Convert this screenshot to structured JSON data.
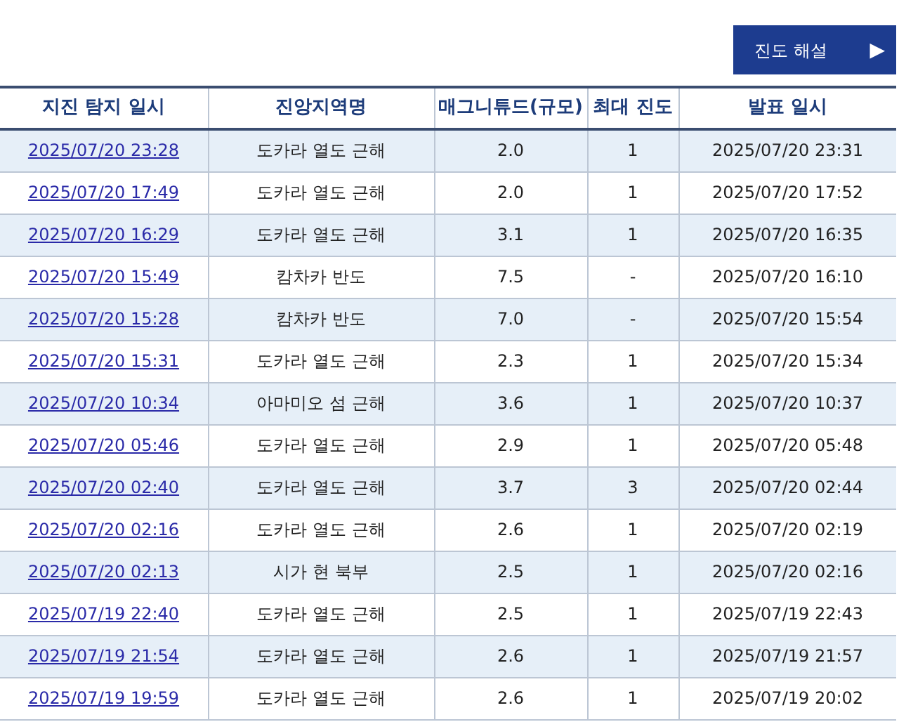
{
  "guide_button": {
    "label": "진도 해설",
    "icon": "▶"
  },
  "table": {
    "columns": [
      "지진 탐지 일시",
      "진앙지역명",
      "매그니튜드(규모)",
      "최대 진도",
      "발표 일시"
    ],
    "rows": [
      {
        "detected": "2025/07/20 23:28",
        "region": "도카라 열도 근해",
        "magnitude": "2.0",
        "max_intensity": "1",
        "announced": "2025/07/20 23:31"
      },
      {
        "detected": "2025/07/20 17:49",
        "region": "도카라 열도 근해",
        "magnitude": "2.0",
        "max_intensity": "1",
        "announced": "2025/07/20 17:52"
      },
      {
        "detected": "2025/07/20 16:29",
        "region": "도카라 열도 근해",
        "magnitude": "3.1",
        "max_intensity": "1",
        "announced": "2025/07/20 16:35"
      },
      {
        "detected": "2025/07/20 15:49",
        "region": "캄차카 반도",
        "magnitude": "7.5",
        "max_intensity": "-",
        "announced": "2025/07/20 16:10"
      },
      {
        "detected": "2025/07/20 15:28",
        "region": "캄차카 반도",
        "magnitude": "7.0",
        "max_intensity": "-",
        "announced": "2025/07/20 15:54"
      },
      {
        "detected": "2025/07/20 15:31",
        "region": "도카라 열도 근해",
        "magnitude": "2.3",
        "max_intensity": "1",
        "announced": "2025/07/20 15:34"
      },
      {
        "detected": "2025/07/20 10:34",
        "region": "아마미오 섬 근해",
        "magnitude": "3.6",
        "max_intensity": "1",
        "announced": "2025/07/20 10:37"
      },
      {
        "detected": "2025/07/20 05:46",
        "region": "도카라 열도 근해",
        "magnitude": "2.9",
        "max_intensity": "1",
        "announced": "2025/07/20 05:48"
      },
      {
        "detected": "2025/07/20 02:40",
        "region": "도카라 열도 근해",
        "magnitude": "3.7",
        "max_intensity": "3",
        "announced": "2025/07/20 02:44"
      },
      {
        "detected": "2025/07/20 02:16",
        "region": "도카라 열도 근해",
        "magnitude": "2.6",
        "max_intensity": "1",
        "announced": "2025/07/20 02:19"
      },
      {
        "detected": "2025/07/20 02:13",
        "region": "시가 현 북부",
        "magnitude": "2.5",
        "max_intensity": "1",
        "announced": "2025/07/20 02:16"
      },
      {
        "detected": "2025/07/19 22:40",
        "region": "도카라 열도 근해",
        "magnitude": "2.5",
        "max_intensity": "1",
        "announced": "2025/07/19 22:43"
      },
      {
        "detected": "2025/07/19 21:54",
        "region": "도카라 열도 근해",
        "magnitude": "2.6",
        "max_intensity": "1",
        "announced": "2025/07/19 21:57"
      },
      {
        "detected": "2025/07/19 19:59",
        "region": "도카라 열도 근해",
        "magnitude": "2.6",
        "max_intensity": "1",
        "announced": "2025/07/19 20:02"
      }
    ]
  }
}
